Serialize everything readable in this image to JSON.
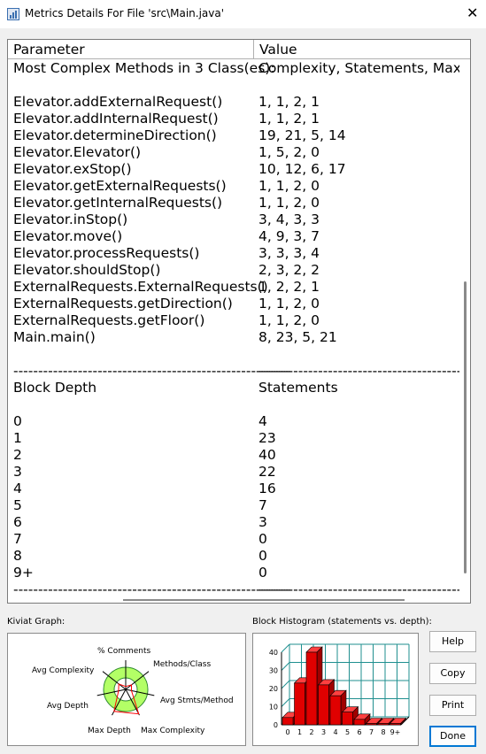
{
  "window": {
    "title": "Metrics Details For File 'src\\Main.java'",
    "close_glyph": "✕"
  },
  "table": {
    "columns": [
      "Parameter",
      "Value"
    ],
    "rows": [
      [
        "Most Complex Methods in 3 Class(es):",
        "Complexity, Statements, Max Dep"
      ],
      [
        "",
        ""
      ],
      [
        "Elevator.addExternalRequest()",
        "1, 1, 2, 1"
      ],
      [
        "Elevator.addInternalRequest()",
        "1, 1, 2, 1"
      ],
      [
        "Elevator.determineDirection()",
        "19, 21, 5, 14"
      ],
      [
        "Elevator.Elevator()",
        "1, 5, 2, 0"
      ],
      [
        "Elevator.exStop()",
        "10, 12, 6, 17"
      ],
      [
        "Elevator.getExternalRequests()",
        "1, 1, 2, 0"
      ],
      [
        "Elevator.getInternalRequests()",
        "1, 1, 2, 0"
      ],
      [
        "Elevator.inStop()",
        "3, 4, 3, 3"
      ],
      [
        "Elevator.move()",
        "4, 9, 3, 7"
      ],
      [
        "Elevator.processRequests()",
        "3, 3, 3, 4"
      ],
      [
        "Elevator.shouldStop()",
        "2, 3, 2, 2"
      ],
      [
        "ExternalRequests.ExternalRequests()",
        "1, 2, 2, 1"
      ],
      [
        "ExternalRequests.getDirection()",
        "1, 1, 2, 0"
      ],
      [
        "ExternalRequests.getFloor()",
        "1, 1, 2, 0"
      ],
      [
        "Main.main()",
        "8, 23, 5, 21"
      ],
      [
        "",
        ""
      ],
      [
        "--------------------------------------------------------",
        "--------------------------------------------------------"
      ],
      [
        "Block Depth",
        "Statements"
      ],
      [
        "",
        ""
      ],
      [
        "0",
        "4"
      ],
      [
        "1",
        "23"
      ],
      [
        "2",
        "40"
      ],
      [
        "3",
        "22"
      ],
      [
        "4",
        "16"
      ],
      [
        "5",
        "7"
      ],
      [
        "6",
        "3"
      ],
      [
        "7",
        "0"
      ],
      [
        "8",
        "0"
      ],
      [
        "9+",
        "0"
      ],
      [
        "--------------------------------------------------------",
        "--------------------------------------------------------"
      ]
    ]
  },
  "kiviat": {
    "label": "Kiviat Graph:",
    "axes": [
      "% Comments",
      "Methods/Class",
      "Avg Stmts/Method",
      "Max Complexity",
      "Max Depth",
      "Avg Depth",
      "Avg Complexity"
    ],
    "values": [
      0.1,
      0.25,
      0.2,
      0.95,
      0.85,
      0.25,
      0.3
    ],
    "colors": {
      "band_fill": "#b3ff66",
      "band_stroke": "#2e8b2e",
      "plot_stroke": "#ff0000",
      "axis": "#000000"
    }
  },
  "histogram": {
    "label": "Block Histogram (statements vs. depth):",
    "chart_data": {
      "type": "bar",
      "title": "Block Histogram (statements vs. depth)",
      "categories": [
        "0",
        "1",
        "2",
        "3",
        "4",
        "5",
        "6",
        "7",
        "8",
        "9+"
      ],
      "values": [
        4,
        23,
        40,
        22,
        16,
        7,
        3,
        0,
        0,
        0
      ],
      "ylim": [
        0,
        40
      ],
      "yticks": [
        "0",
        "10",
        "20",
        "30",
        "40"
      ],
      "xlabel": "",
      "ylabel": "",
      "grid": true,
      "bar_color": "#e00000"
    }
  },
  "buttons": {
    "help": "Help",
    "copy": "Copy",
    "print": "Print",
    "done": "Done"
  }
}
